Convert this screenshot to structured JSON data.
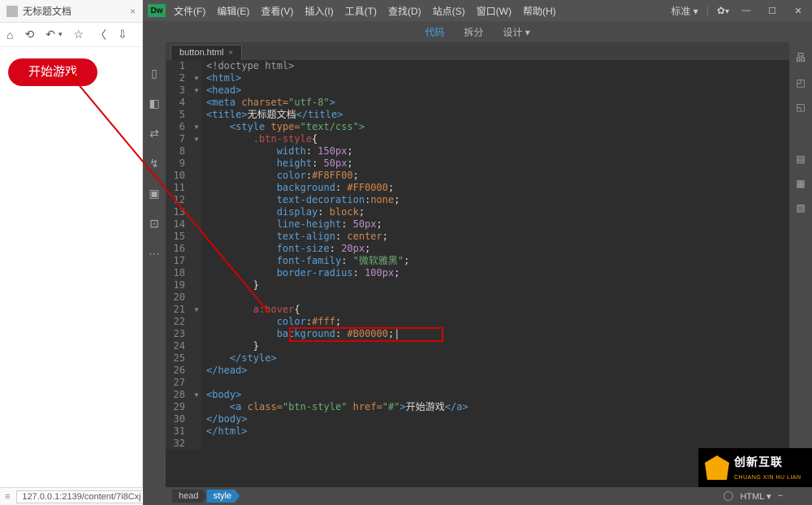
{
  "browser": {
    "tab_title": "无标题文档",
    "tools": {
      "home": "⌂",
      "reload": "⟲",
      "undo": "↶",
      "dd": "▾",
      "star": "☆",
      "back": "〈",
      "download": "⇩"
    },
    "button_text": "开始游戏",
    "status_url": "127.0.0.1:2139/content/7i8Cxj"
  },
  "dw": {
    "logo": "Dw",
    "menu": [
      "文件(F)",
      "编辑(E)",
      "查看(V)",
      "插入(I)",
      "工具(T)",
      "查找(D)",
      "站点(S)",
      "窗口(W)",
      "帮助(H)"
    ],
    "workspace": "标准",
    "subbar": {
      "code": "代码",
      "split": "拆分",
      "design": "设计"
    },
    "file_tab": "button.html",
    "left_tools": [
      "▯",
      "◧",
      "⇄",
      "↯",
      "▣",
      "⊡",
      "⋯"
    ],
    "right_tools": [
      "品",
      "◰",
      "◱",
      "▤",
      "▦",
      "▧"
    ],
    "status": {
      "crumb1": "head",
      "crumb2": "style",
      "html": "HTML",
      "enc": "~"
    }
  },
  "brand": {
    "name": "创新互联",
    "sub": "CHUANG XIN HU LIAN"
  },
  "code": [
    {
      "n": 1,
      "f": "",
      "h": "<span class='t-gray'>&lt;!doctype html&gt;</span>"
    },
    {
      "n": 2,
      "f": "▾",
      "h": "<span class='t-blue'>&lt;html&gt;</span>"
    },
    {
      "n": 3,
      "f": "▾",
      "h": "<span class='t-blue'>&lt;head&gt;</span>"
    },
    {
      "n": 4,
      "f": "",
      "h": "<span class='t-blue'>&lt;meta</span> <span class='t-orange'>charset=</span><span class='t-green'>\"utf-8\"</span><span class='t-blue'>&gt;</span>"
    },
    {
      "n": 5,
      "f": "",
      "h": "<span class='t-blue'>&lt;title&gt;</span><span class='t-white'>无标题文档</span><span class='t-blue'>&lt;/title&gt;</span>"
    },
    {
      "n": 6,
      "f": "▾",
      "h": "    <span class='t-blue'>&lt;style</span> <span class='t-orange'>type=</span><span class='t-green'>\"text/css\"</span><span class='t-blue'>&gt;</span>"
    },
    {
      "n": 7,
      "f": "▾",
      "h": "        <span class='t-red'>.btn-style</span><span class='t-white'>{</span>"
    },
    {
      "n": 8,
      "f": "",
      "h": "            <span class='t-blue'>width</span><span class='t-white'>: </span><span class='t-purple'>150px</span><span class='t-white'>;</span>"
    },
    {
      "n": 9,
      "f": "",
      "h": "            <span class='t-blue'>height</span><span class='t-white'>: </span><span class='t-purple'>50px</span><span class='t-white'>;</span>"
    },
    {
      "n": 10,
      "f": "",
      "h": "            <span class='t-blue'>color</span><span class='t-white'>:</span><span class='t-orange'>#F8FF00</span><span class='t-white'>;</span>"
    },
    {
      "n": 11,
      "f": "",
      "h": "            <span class='t-blue'>background</span><span class='t-white'>: </span><span class='t-orange'>#FF0000</span><span class='t-white'>;</span>"
    },
    {
      "n": 12,
      "f": "",
      "h": "            <span class='t-blue'>text-decoration</span><span class='t-white'>:</span><span class='t-orange'>none</span><span class='t-white'>;</span>"
    },
    {
      "n": 13,
      "f": "",
      "h": "            <span class='t-blue'>display</span><span class='t-white'>: </span><span class='t-orange'>block</span><span class='t-white'>;</span>"
    },
    {
      "n": 14,
      "f": "",
      "h": "            <span class='t-blue'>line-height</span><span class='t-white'>: </span><span class='t-purple'>50px</span><span class='t-white'>;</span>"
    },
    {
      "n": 15,
      "f": "",
      "h": "            <span class='t-blue'>text-align</span><span class='t-white'>: </span><span class='t-orange'>center</span><span class='t-white'>;</span>"
    },
    {
      "n": 16,
      "f": "",
      "h": "            <span class='t-blue'>font-size</span><span class='t-white'>: </span><span class='t-purple'>20px</span><span class='t-white'>;</span>"
    },
    {
      "n": 17,
      "f": "",
      "h": "            <span class='t-blue'>font-family</span><span class='t-white'>: </span><span class='t-green'>\"微软雅黑\"</span><span class='t-white'>;</span>"
    },
    {
      "n": 18,
      "f": "",
      "h": "            <span class='t-blue'>border-radius</span><span class='t-white'>: </span><span class='t-purple'>100px</span><span class='t-white'>;</span>"
    },
    {
      "n": 19,
      "f": "",
      "h": "        <span class='t-white'>}</span>"
    },
    {
      "n": 20,
      "f": "",
      "h": ""
    },
    {
      "n": 21,
      "f": "▾",
      "h": "        <span class='t-red'>a:hover</span><span class='t-white'>{</span>"
    },
    {
      "n": 22,
      "f": "",
      "h": "            <span class='t-blue'>color</span><span class='t-white'>:</span><span class='t-orange'>#fff</span><span class='t-white'>;</span>"
    },
    {
      "n": 23,
      "f": "",
      "h": "            <span class='t-blue'>background</span><span class='t-white'>: </span><span class='t-orange'>#B00000</span><span class='t-white'>;|</span>"
    },
    {
      "n": 24,
      "f": "",
      "h": "        <span class='t-white'>}</span>"
    },
    {
      "n": 25,
      "f": "",
      "h": "    <span class='t-blue'>&lt;/style&gt;</span>"
    },
    {
      "n": 26,
      "f": "",
      "h": "<span class='t-blue'>&lt;/head&gt;</span>"
    },
    {
      "n": 27,
      "f": "",
      "h": ""
    },
    {
      "n": 28,
      "f": "▾",
      "h": "<span class='t-blue'>&lt;body&gt;</span>"
    },
    {
      "n": 29,
      "f": "",
      "h": "    <span class='t-blue'>&lt;a</span> <span class='t-orange'>class=</span><span class='t-green'>\"btn-style\"</span> <span class='t-orange'>href=</span><span class='t-green'>\"#\"</span><span class='t-blue'>&gt;</span><span class='t-white'>开始游戏</span><span class='t-blue'>&lt;/a&gt;</span>"
    },
    {
      "n": 30,
      "f": "",
      "h": "<span class='t-blue'>&lt;/body&gt;</span>"
    },
    {
      "n": 31,
      "f": "",
      "h": "<span class='t-blue'>&lt;/html&gt;</span>"
    },
    {
      "n": 32,
      "f": "",
      "h": ""
    }
  ]
}
